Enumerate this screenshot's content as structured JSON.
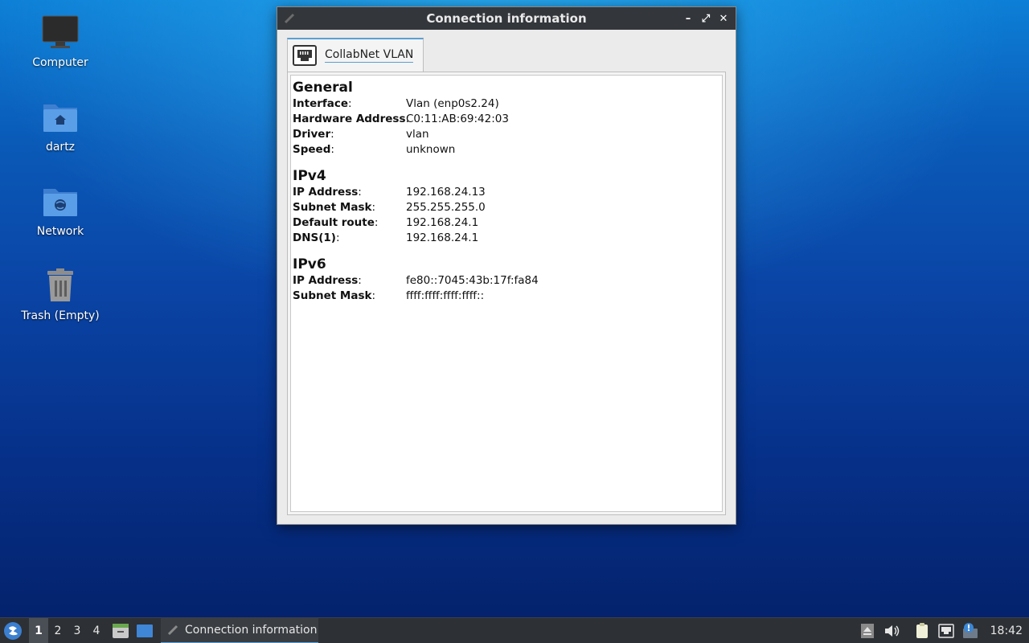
{
  "desktop": {
    "icons": [
      {
        "label": "Computer",
        "icon": "computer-icon"
      },
      {
        "label": "dartz",
        "icon": "home-folder-icon"
      },
      {
        "label": "Network",
        "icon": "network-folder-icon"
      },
      {
        "label": "Trash (Empty)",
        "icon": "trash-icon"
      }
    ]
  },
  "window": {
    "title": "Connection information",
    "buttons": {
      "minimize": "–",
      "maximize": "⤢",
      "close": "✕"
    },
    "tab": {
      "label": "CollabNet VLAN",
      "icon": "ethernet-port-icon"
    },
    "sections": {
      "general": {
        "title": "General",
        "rows": [
          {
            "key": "Interface",
            "value": "Vlan (enp0s2.24)"
          },
          {
            "key": "Hardware Address",
            "value": "C0:11:AB:69:42:03"
          },
          {
            "key": "Driver",
            "value": "vlan"
          },
          {
            "key": "Speed",
            "value": "unknown"
          }
        ]
      },
      "ipv4": {
        "title": "IPv4",
        "rows": [
          {
            "key": "IP Address",
            "value": "192.168.24.13"
          },
          {
            "key": "Subnet Mask",
            "value": "255.255.255.0"
          },
          {
            "key": "Default route",
            "value": "192.168.24.1"
          },
          {
            "key": "DNS(1)",
            "value": "192.168.24.1"
          }
        ]
      },
      "ipv6": {
        "title": "IPv6",
        "rows": [
          {
            "key": "IP Address",
            "value": "fe80::7045:43b:17f:fa84"
          },
          {
            "key": "Subnet Mask",
            "value": "ffff:ffff:ffff:ffff::"
          }
        ]
      }
    }
  },
  "taskbar": {
    "workspaces": [
      "1",
      "2",
      "3",
      "4"
    ],
    "active_workspace": "1",
    "task_label": "Connection information",
    "clock": "18:42"
  },
  "colors": {
    "accent": "#5a9fd4",
    "titlebar": "#33363b",
    "taskbar": "#2d3034"
  }
}
